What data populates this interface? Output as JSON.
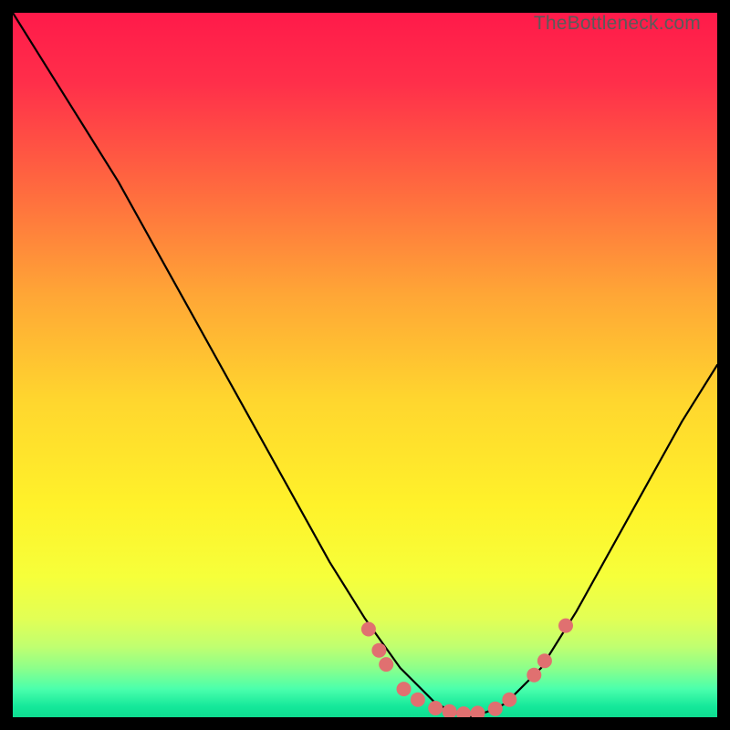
{
  "watermark": "TheBottleneck.com",
  "chart_data": {
    "type": "line",
    "title": "",
    "xlabel": "",
    "ylabel": "",
    "xlim": [
      0,
      100
    ],
    "ylim": [
      0,
      100
    ],
    "grid": false,
    "legend": false,
    "series": [
      {
        "name": "bottleneck-curve",
        "x": [
          0,
          5,
          10,
          15,
          20,
          25,
          30,
          35,
          40,
          45,
          50,
          55,
          58,
          60,
          62,
          65,
          68,
          70,
          75,
          80,
          85,
          90,
          95,
          100
        ],
        "values": [
          100,
          92,
          84,
          76,
          67,
          58,
          49,
          40,
          31,
          22,
          14,
          7,
          4,
          2,
          1,
          0,
          1,
          2,
          7,
          15,
          24,
          33,
          42,
          50
        ]
      }
    ],
    "markers": [
      {
        "x": 50.5,
        "y": 12.5
      },
      {
        "x": 52.0,
        "y": 9.5
      },
      {
        "x": 53.0,
        "y": 7.5
      },
      {
        "x": 55.5,
        "y": 4.0
      },
      {
        "x": 57.5,
        "y": 2.5
      },
      {
        "x": 60.0,
        "y": 1.3
      },
      {
        "x": 62.0,
        "y": 0.8
      },
      {
        "x": 64.0,
        "y": 0.5
      },
      {
        "x": 66.0,
        "y": 0.6
      },
      {
        "x": 68.5,
        "y": 1.2
      },
      {
        "x": 70.5,
        "y": 2.5
      },
      {
        "x": 74.0,
        "y": 6.0
      },
      {
        "x": 75.5,
        "y": 8.0
      },
      {
        "x": 78.5,
        "y": 13.0
      }
    ],
    "gradient_stops": [
      {
        "offset": 0.0,
        "color": "#ff1a4a"
      },
      {
        "offset": 0.1,
        "color": "#ff2f4a"
      },
      {
        "offset": 0.25,
        "color": "#ff6a3f"
      },
      {
        "offset": 0.4,
        "color": "#ffa636"
      },
      {
        "offset": 0.55,
        "color": "#ffd62e"
      },
      {
        "offset": 0.7,
        "color": "#fff22a"
      },
      {
        "offset": 0.8,
        "color": "#f6ff3a"
      },
      {
        "offset": 0.86,
        "color": "#e2ff55"
      },
      {
        "offset": 0.9,
        "color": "#c0ff70"
      },
      {
        "offset": 0.93,
        "color": "#8dff8a"
      },
      {
        "offset": 0.96,
        "color": "#4affac"
      },
      {
        "offset": 0.985,
        "color": "#14e89a"
      },
      {
        "offset": 1.0,
        "color": "#0fdc90"
      }
    ],
    "marker_color": "#e07070",
    "curve_color": "#000000"
  }
}
